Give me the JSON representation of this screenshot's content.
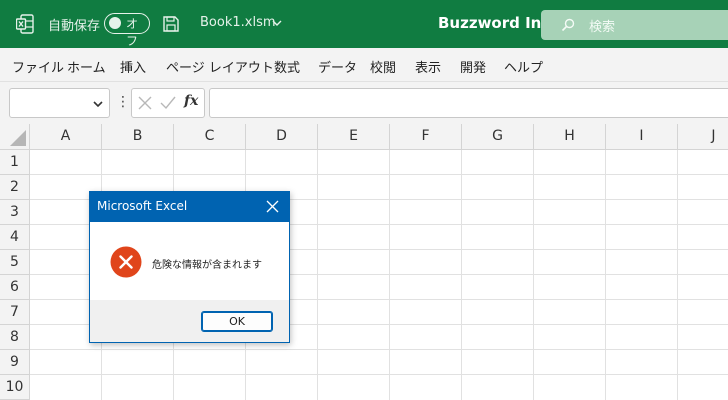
{
  "titlebar": {
    "autosave_label": "自動保存",
    "autosave_toggle": "オフ",
    "document_title": "Book1.xlsm",
    "company": "Buzzword Inc.",
    "search_placeholder": "検索",
    "background_color": "#107c41"
  },
  "menu": {
    "items": [
      "ファイル",
      "ホーム",
      "挿入",
      "ページ レイアウト",
      "数式",
      "データ",
      "校閲",
      "表示",
      "開発",
      "ヘルプ"
    ]
  },
  "formula_bar": {
    "name_box_value": "",
    "function_symbol": "fx",
    "formula_value": ""
  },
  "sheet": {
    "columns": [
      "A",
      "B",
      "C",
      "D",
      "E",
      "F",
      "G",
      "H",
      "I",
      "J"
    ],
    "rows": [
      "1",
      "2",
      "3",
      "4",
      "5",
      "6",
      "7",
      "8",
      "9",
      "10"
    ]
  },
  "dialog": {
    "title": "Microsoft Excel",
    "icon": "error-icon",
    "message": "危険な情報が含まれます",
    "ok_label": "OK",
    "accent_color": "#0063b1",
    "error_color": "#e0451b"
  }
}
